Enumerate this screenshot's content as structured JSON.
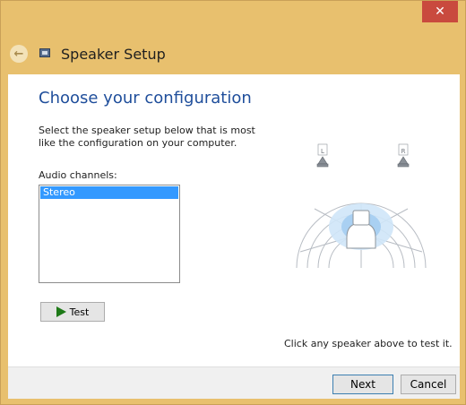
{
  "window": {
    "title": "Speaker Setup",
    "close_glyph": "✕"
  },
  "header": {
    "back_glyph": "←"
  },
  "main": {
    "heading": "Choose your configuration",
    "instructions": "Select the speaker setup below that is most like the configuration on your computer.",
    "channels_label": "Audio channels:",
    "channels": [
      "Stereo"
    ],
    "test_label": "Test",
    "hint": "Click any speaker above to test it."
  },
  "diagram": {
    "left_label": "L",
    "right_label": "R"
  },
  "footer": {
    "next_label": "Next",
    "cancel_label": "Cancel"
  },
  "colors": {
    "accent": "#1f4e9b",
    "selection": "#3399ff",
    "frame": "#e8c06e",
    "close": "#c94a3e"
  }
}
